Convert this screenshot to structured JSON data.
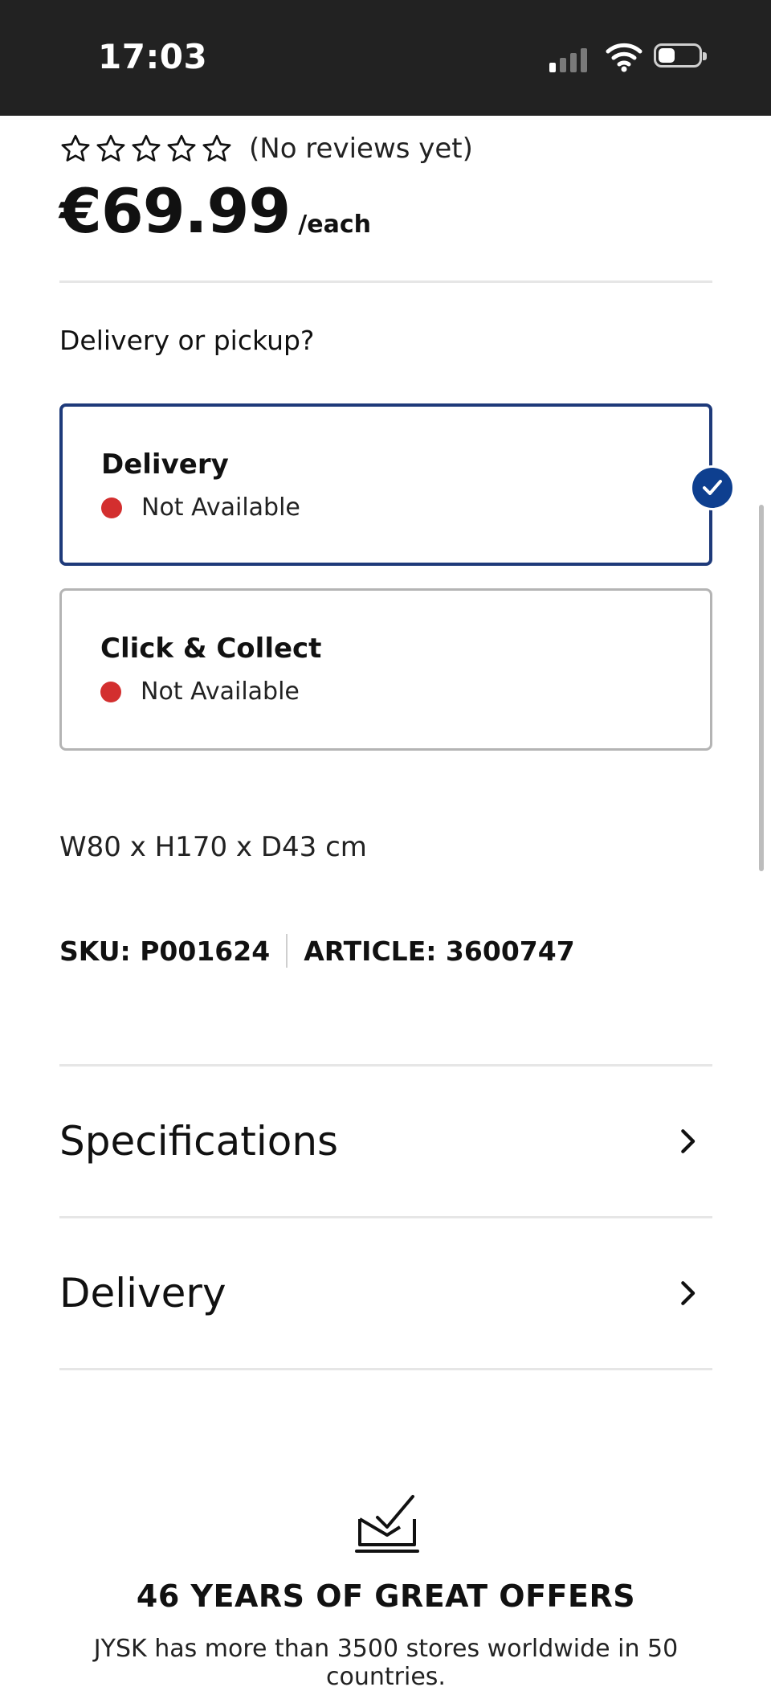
{
  "status_bar": {
    "time": "17:03"
  },
  "product": {
    "reviews_text": "(No reviews yet)",
    "star_count_filled": 0,
    "price": "€69.99",
    "price_unit": "/each",
    "dimensions": "W80 x H170 x D43 cm",
    "sku": "SKU: P001624",
    "article": "ARTICLE: 3600747"
  },
  "fulfillment": {
    "question": "Delivery or pickup?",
    "options": [
      {
        "title": "Delivery",
        "status": "Not Available",
        "selected": true
      },
      {
        "title": "Click & Collect",
        "status": "Not Available",
        "selected": false
      }
    ]
  },
  "accordions": [
    {
      "label": "Specifications"
    },
    {
      "label": "Delivery"
    }
  ],
  "footer": {
    "heading": "46 YEARS OF GREAT OFFERS",
    "text": "JYSK has more than 3500 stores worldwide in 50 countries."
  },
  "colors": {
    "accent": "#1e3a7a",
    "check_badge": "#0e3f8f",
    "status_unavailable": "#d32f2f",
    "status_bar_bg": "#222222"
  }
}
